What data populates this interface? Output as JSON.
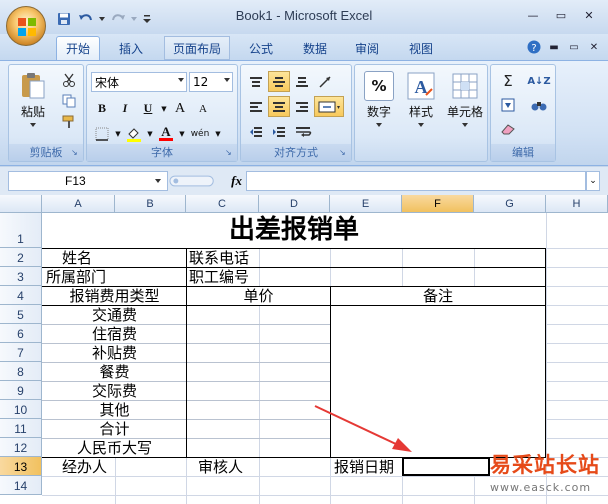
{
  "window": {
    "title": "Book1 - Microsoft Excel",
    "minimize_glyph": "—",
    "maximize_glyph": "▭",
    "close_glyph": "✕"
  },
  "ribbon_tabs": [
    {
      "label": "开始",
      "active": true
    },
    {
      "label": "插入",
      "active": false
    },
    {
      "label": "页面布局",
      "active": false
    },
    {
      "label": "公式",
      "active": false
    },
    {
      "label": "数据",
      "active": false
    },
    {
      "label": "审阅",
      "active": false
    },
    {
      "label": "视图",
      "active": false
    }
  ],
  "ribbon": {
    "clipboard": {
      "group_label": "剪贴板",
      "paste_label": "粘贴"
    },
    "font": {
      "group_label": "字体",
      "font_name": "宋体",
      "font_size": "12",
      "bold": "B",
      "italic": "I",
      "underline": "U",
      "grow": "A",
      "shrink": "A",
      "color_letter": "A",
      "phonetic": "wén"
    },
    "alignment": {
      "group_label": "对齐方式"
    },
    "number": {
      "label": "数字",
      "symbol": "%"
    },
    "styles": {
      "label": "样式"
    },
    "cells": {
      "label": "单元格"
    },
    "editing": {
      "group_label": "编辑",
      "sum_symbol": "Σ",
      "sort_symbol": "A↓Z"
    }
  },
  "formula_bar": {
    "name_box": "F13",
    "fx_label": "fx",
    "formula": ""
  },
  "columns": [
    "A",
    "B",
    "C",
    "D",
    "E",
    "F",
    "G",
    "H"
  ],
  "selected_column": "F",
  "rows": [
    "1",
    "2",
    "3",
    "4",
    "5",
    "6",
    "7",
    "8",
    "9",
    "10",
    "11",
    "12",
    "13",
    "14"
  ],
  "selected_row": "13",
  "sheet": {
    "title": "出差报销单",
    "cells": {
      "r2_name": "姓名",
      "r2_phone": "联系电话",
      "r3_dept": "所属部门",
      "r3_empno": "职工编号",
      "r4_type": "报销费用类型",
      "r4_price": "单价",
      "r4_notes": "备注",
      "r5": "交通费",
      "r6": "住宿费",
      "r7": "补贴费",
      "r8": "餐费",
      "r9": "交际费",
      "r10": "其他",
      "r11": "合计",
      "r12": "人民币大写",
      "r13_handler": "经办人",
      "r13_reviewer": "审核人",
      "r13_date": "报销日期"
    }
  },
  "watermark": {
    "text": "易采站长站",
    "url": "www.easck.com"
  },
  "colors": {
    "accent_red": "#e53935",
    "selection": "#f1c15f"
  }
}
